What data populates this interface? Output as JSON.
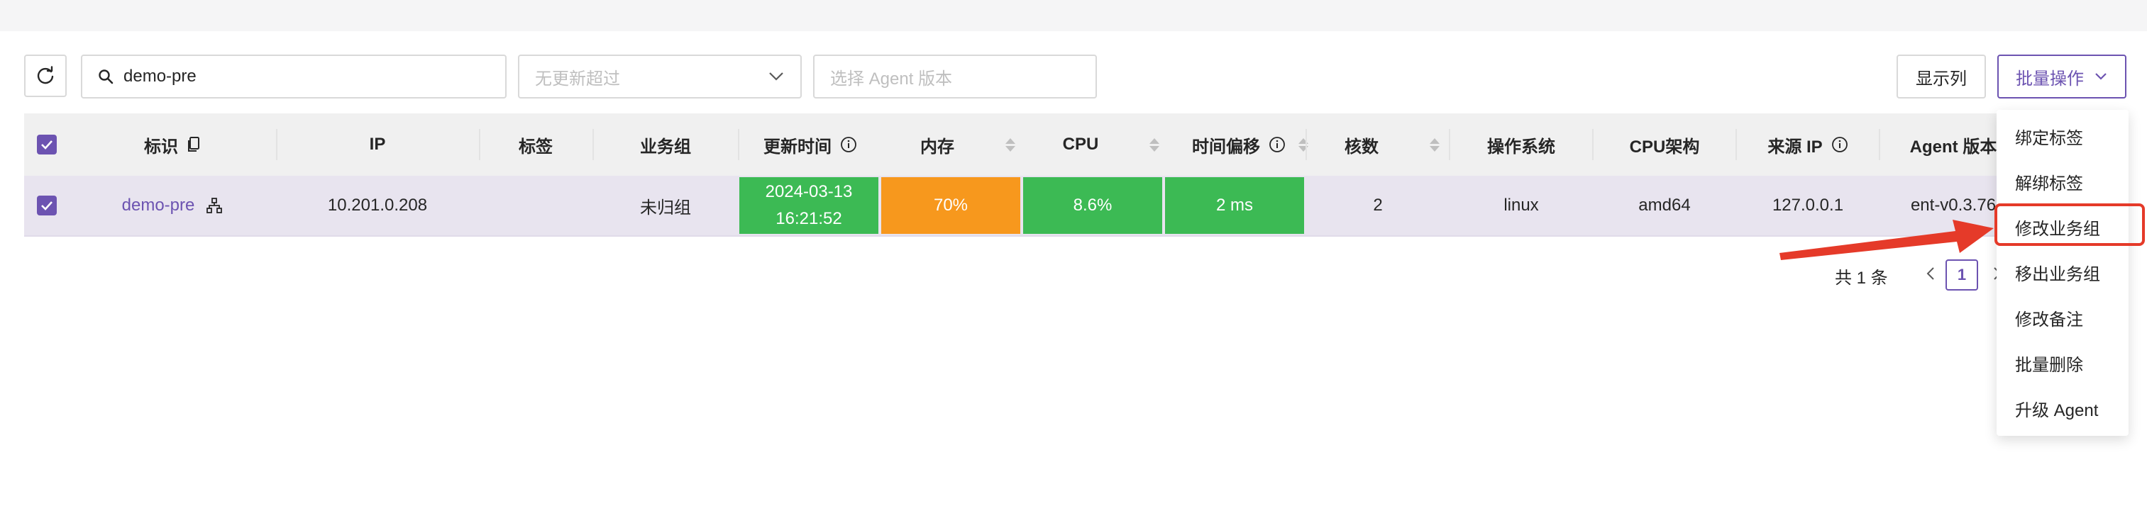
{
  "toolbar": {
    "search_value": "demo-pre",
    "update_filter_placeholder": "无更新超过",
    "agent_version_placeholder": "选择 Agent 版本",
    "show_columns_label": "显示列",
    "batch_ops_label": "批量操作"
  },
  "table": {
    "headers": {
      "ident": "标识",
      "ip": "IP",
      "tags": "标签",
      "group": "业务组",
      "update_time": "更新时间",
      "memory": "内存",
      "cpu": "CPU",
      "offset": "时间偏移",
      "cores": "核数",
      "os": "操作系统",
      "arch": "CPU架构",
      "source_ip": "来源 IP",
      "agent_version": "Agent 版本"
    },
    "rows": [
      {
        "ident": "demo-pre",
        "ip": "10.201.0.208",
        "tags": "",
        "group": "未归组",
        "update_date": "2024-03-13",
        "update_time": "16:21:52",
        "memory": "70%",
        "cpu": "8.6%",
        "offset": "2 ms",
        "cores": "2",
        "os": "linux",
        "arch": "amd64",
        "source_ip": "127.0.0.1",
        "agent_version": "ent-v0.3.76"
      }
    ]
  },
  "pagination": {
    "total": "共 1 条",
    "current": "1"
  },
  "batch_menu": {
    "items": [
      "绑定标签",
      "解绑标签",
      "修改业务组",
      "移出业务组",
      "修改备注",
      "批量删除",
      "升级 Agent"
    ],
    "highlighted": "修改业务组"
  },
  "colors": {
    "accent": "#6c53b1",
    "good": "#3cba54",
    "warn": "#f7981d",
    "annotation": "#e53a29"
  }
}
